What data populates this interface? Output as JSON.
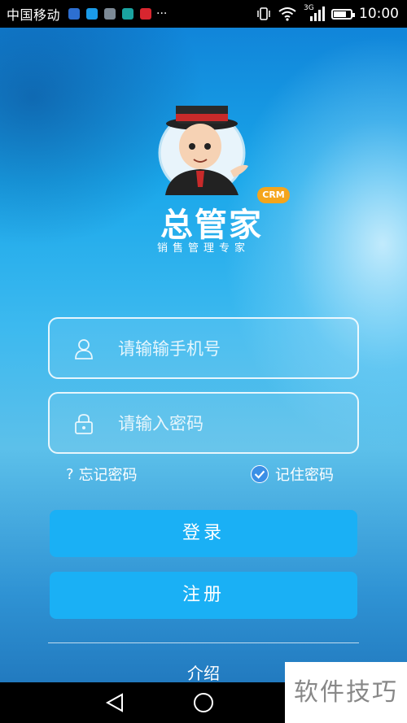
{
  "status_bar": {
    "carrier": "中国移动",
    "more": "···",
    "network": "3G",
    "time": "10:00"
  },
  "brand": {
    "name": "总管家",
    "badge": "CRM",
    "tagline": "销售管理专家"
  },
  "form": {
    "phone_placeholder": "请输输手机号",
    "password_placeholder": "请输入密码",
    "forgot_label": "忘记密码",
    "remember_label": "记住密码",
    "remember_checked": true
  },
  "buttons": {
    "login": "登录",
    "register": "注册"
  },
  "footer": {
    "intro": "介绍",
    "watermark": "软件技巧"
  },
  "colors": {
    "accent": "#1ab0f5",
    "badge": "#f4a51c"
  }
}
